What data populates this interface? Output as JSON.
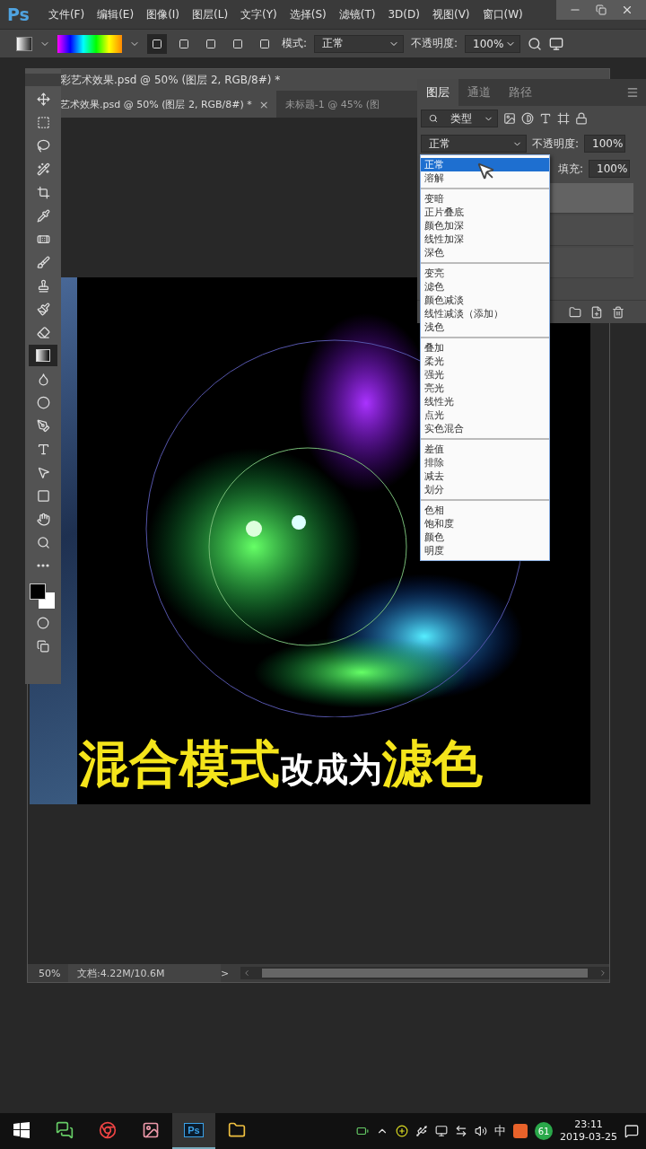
{
  "menubar": {
    "logo": "Ps",
    "items": [
      "文件(F)",
      "编辑(E)",
      "图像(I)",
      "图层(L)",
      "文字(Y)",
      "选择(S)",
      "滤镜(T)",
      "3D(D)",
      "视图(V)",
      "窗口(W)"
    ]
  },
  "options_bar": {
    "gradient_types": [
      {
        "selected": true
      },
      {
        "selected": false
      },
      {
        "selected": false
      },
      {
        "selected": false
      },
      {
        "selected": false
      }
    ],
    "mode_label": "模式:",
    "mode_value": "正常",
    "opacity_label": "不透明度:",
    "opacity_value": "100%"
  },
  "toolbox": {
    "tools": [
      {
        "selected": false
      },
      {
        "selected": false
      },
      {
        "selected": false
      },
      {
        "selected": false
      },
      {
        "selected": false
      },
      {
        "selected": false
      },
      {
        "selected": false
      },
      {
        "selected": false
      },
      {
        "selected": false
      },
      {
        "selected": false
      },
      {
        "selected": false
      },
      {
        "selected": true
      },
      {
        "selected": false
      },
      {
        "selected": false
      },
      {
        "selected": false
      },
      {
        "selected": false
      },
      {
        "selected": false
      },
      {
        "selected": false
      },
      {
        "selected": false
      },
      {
        "selected": false
      },
      {
        "selected": false
      }
    ]
  },
  "document": {
    "title": "彩艺术效果.psd @ 50% (图层 2, RGB/8#) *",
    "tabs": [
      {
        "label": "艺术效果.psd @ 50% (图层 2, RGB/8#) *",
        "close": "×",
        "selected": true
      },
      {
        "label": "未标题-1 @ 45% (图",
        "selected": false
      }
    ],
    "caption": [
      {
        "text": "混合模式",
        "kind": "highlight"
      },
      {
        "text": "改成为",
        "kind": "plain"
      },
      {
        "text": "滤色",
        "kind": "highlight"
      }
    ],
    "status": {
      "zoom": "50%",
      "doc_info": "文档:4.22M/10.6M",
      "arrow": ">"
    }
  },
  "layers_panel": {
    "tabs": [
      {
        "label": "图层",
        "selected": true
      },
      {
        "label": "通道",
        "selected": false
      },
      {
        "label": "路径",
        "selected": false
      }
    ],
    "filter_value": "类型",
    "blend_value": "正常",
    "opacity_label": "不透明度:",
    "opacity_value": "100%",
    "fill_label": "填充:",
    "fill_value": "100%",
    "layers": [
      {
        "selected": true
      },
      {
        "selected": false
      },
      {
        "selected": false
      }
    ]
  },
  "blend_menu": {
    "groups": [
      {
        "items": [
          {
            "label": "正常",
            "selected": true
          },
          {
            "label": "溶解",
            "selected": false
          }
        ]
      },
      {
        "items": [
          {
            "label": "变暗",
            "selected": false
          },
          {
            "label": "正片叠底",
            "selected": false
          },
          {
            "label": "颜色加深",
            "selected": false
          },
          {
            "label": "线性加深",
            "selected": false
          },
          {
            "label": "深色",
            "selected": false
          }
        ]
      },
      {
        "items": [
          {
            "label": "变亮",
            "selected": false
          },
          {
            "label": "滤色",
            "selected": false
          },
          {
            "label": "颜色减淡",
            "selected": false
          },
          {
            "label": "线性减淡（添加）",
            "selected": false
          },
          {
            "label": "浅色",
            "selected": false
          }
        ]
      },
      {
        "items": [
          {
            "label": "叠加",
            "selected": false
          },
          {
            "label": "柔光",
            "selected": false
          },
          {
            "label": "强光",
            "selected": false
          },
          {
            "label": "亮光",
            "selected": false
          },
          {
            "label": "线性光",
            "selected": false
          },
          {
            "label": "点光",
            "selected": false
          },
          {
            "label": "实色混合",
            "selected": false
          }
        ]
      },
      {
        "items": [
          {
            "label": "差值",
            "selected": false
          },
          {
            "label": "排除",
            "selected": false
          },
          {
            "label": "减去",
            "selected": false
          },
          {
            "label": "划分",
            "selected": false
          }
        ]
      },
      {
        "items": [
          {
            "label": "色相",
            "selected": false
          },
          {
            "label": "饱和度",
            "selected": false
          },
          {
            "label": "颜色",
            "selected": false
          },
          {
            "label": "明度",
            "selected": false
          }
        ]
      }
    ]
  },
  "taskbar": {
    "apps": [
      {
        "kind": "start",
        "selected": false
      },
      {
        "kind": "chat",
        "selected": false
      },
      {
        "kind": "browser",
        "selected": false
      },
      {
        "kind": "photos",
        "selected": false
      },
      {
        "kind": "ps",
        "label": "Ps",
        "selected": true
      },
      {
        "kind": "folder",
        "selected": false
      }
    ],
    "ime": "中",
    "badge": "61",
    "time": "23:11",
    "date": "2019-03-25"
  }
}
